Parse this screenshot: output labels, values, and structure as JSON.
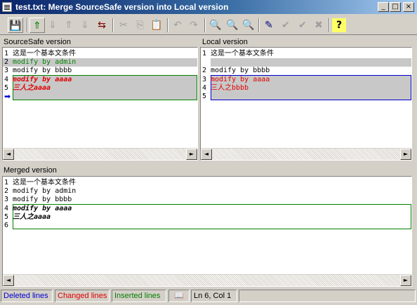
{
  "window": {
    "title": "test.txt: Merge SourceSafe version into Local version",
    "controls": {
      "minimize": "_",
      "maximize": "□",
      "close": "×"
    }
  },
  "toolbar": {
    "buttons": [
      {
        "name": "save-tool",
        "glyph": "💾"
      },
      {
        "name": "first-diff-tool",
        "glyph": "⇑"
      },
      {
        "name": "next-diff-down-tool",
        "glyph": "⇓"
      },
      {
        "name": "prev-diff-tool",
        "glyph": "⇑"
      },
      {
        "name": "next-diff-tool",
        "glyph": "⇓"
      },
      {
        "name": "sync-tool",
        "glyph": "⇆"
      },
      {
        "name": "cut-tool",
        "glyph": "✂"
      },
      {
        "name": "copy-tool",
        "glyph": "⎘"
      },
      {
        "name": "paste-tool",
        "glyph": "📋"
      },
      {
        "name": "undo-tool",
        "glyph": "↶"
      },
      {
        "name": "redo-tool",
        "glyph": "↷"
      },
      {
        "name": "find-tool",
        "glyph": "🔍"
      },
      {
        "name": "find-next-tool",
        "glyph": "🔍"
      },
      {
        "name": "find-prev-tool",
        "glyph": "🔍"
      },
      {
        "name": "apply-change-tool",
        "glyph": "✎"
      },
      {
        "name": "accept-tool",
        "glyph": "✔"
      },
      {
        "name": "accept-all-tool",
        "glyph": "✔"
      },
      {
        "name": "reject-tool",
        "glyph": "✖"
      },
      {
        "name": "help-tool",
        "glyph": "?"
      }
    ]
  },
  "sourcesafe": {
    "label": "SourceSafe version",
    "lines": [
      {
        "num": "1",
        "text": "这是一个基本文条件"
      },
      {
        "num": "2",
        "text": "modify by admin"
      },
      {
        "num": "3",
        "text": "modify by bbbb"
      },
      {
        "num": "4",
        "text": "modify by aaaa"
      },
      {
        "num": "5",
        "text": "三人之aaaa"
      }
    ]
  },
  "local": {
    "label": "Local version",
    "lines": [
      {
        "num": "1",
        "text": "这是一个基本文条件"
      },
      {
        "num": "2",
        "text": "modify by bbbb"
      },
      {
        "num": "3",
        "text": "modify by aaaa"
      },
      {
        "num": "4",
        "text": "三人之bbbb"
      },
      {
        "num": "5",
        "text": ""
      }
    ]
  },
  "merged": {
    "label": "Merged version",
    "lines": [
      {
        "num": "1",
        "text": "这是一个基本文条件"
      },
      {
        "num": "2",
        "text": "modify by admin"
      },
      {
        "num": "3",
        "text": "modify by bbbb"
      },
      {
        "num": "4",
        "text": "modify by aaaa"
      },
      {
        "num": "5",
        "text": "三人之aaaa"
      },
      {
        "num": "6",
        "text": ""
      }
    ]
  },
  "scroll": {
    "left": "◄",
    "right": "►"
  },
  "status": {
    "deleted": "Deleted lines",
    "changed": "Changed lines",
    "inserted": "Inserted lines",
    "book_icon": "📖",
    "position": "Ln 6, Col 1"
  },
  "colors": {
    "deleted": "#0000cc",
    "changed": "#e00000",
    "inserted": "#008000"
  }
}
